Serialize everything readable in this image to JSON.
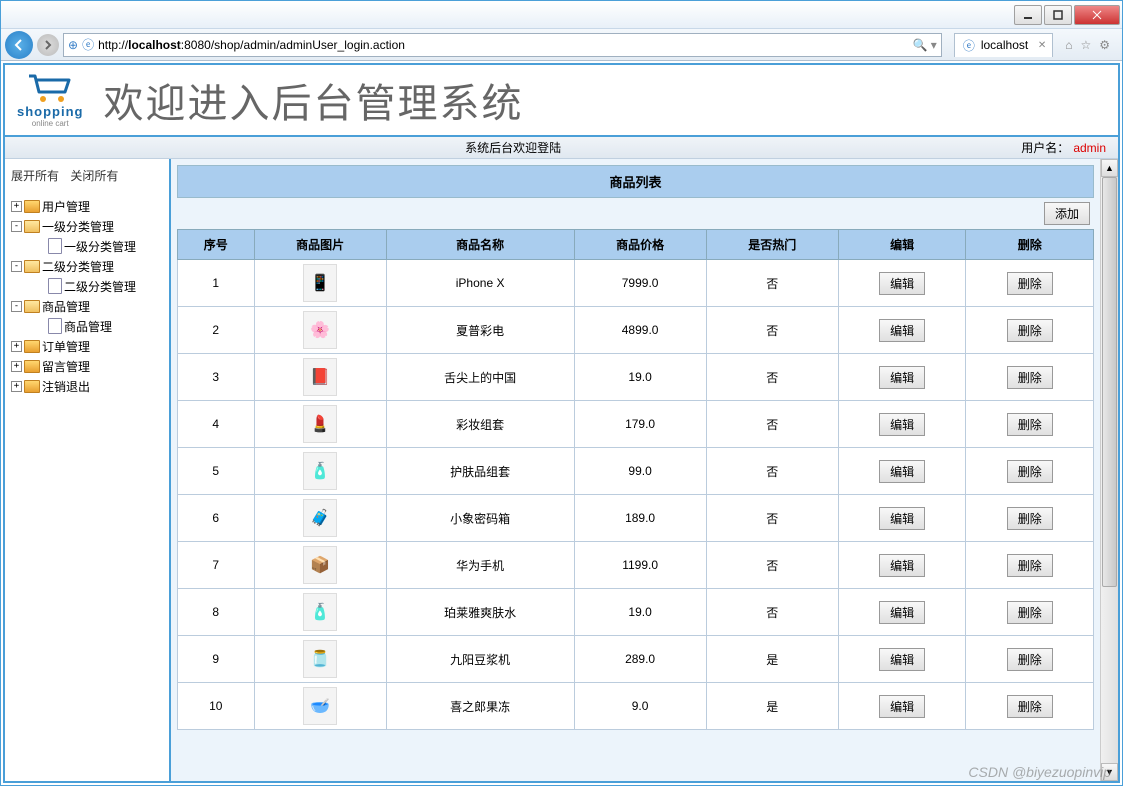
{
  "browser": {
    "url_prefix": "http://",
    "url_host": "localhost",
    "url_port_path": ":8080/shop/admin/adminUser_login.action",
    "tab_title": "localhost",
    "search_hint": ""
  },
  "logo": {
    "line1": "shopping",
    "line2": "online cart"
  },
  "header_title": "欢迎进入后台管理系统",
  "statusbar": {
    "welcome": "系统后台欢迎登陆",
    "user_label": "用户名：",
    "username": "admin"
  },
  "sidebar": {
    "expand_all": "展开所有",
    "collapse_all": "关闭所有",
    "nodes": [
      {
        "label": "用户管理",
        "icon": "folder-closed",
        "toggle": "+",
        "level": 1
      },
      {
        "label": "一级分类管理",
        "icon": "folder-open",
        "toggle": "-",
        "level": 1
      },
      {
        "label": "一级分类管理",
        "icon": "page",
        "toggle": "",
        "level": 2
      },
      {
        "label": "二级分类管理",
        "icon": "folder-open",
        "toggle": "-",
        "level": 1
      },
      {
        "label": "二级分类管理",
        "icon": "page",
        "toggle": "",
        "level": 2
      },
      {
        "label": "商品管理",
        "icon": "folder-open",
        "toggle": "-",
        "level": 1
      },
      {
        "label": "商品管理",
        "icon": "page",
        "toggle": "",
        "level": 2
      },
      {
        "label": "订单管理",
        "icon": "folder-closed",
        "toggle": "+",
        "level": 1
      },
      {
        "label": "留言管理",
        "icon": "folder-closed",
        "toggle": "+",
        "level": 1
      },
      {
        "label": "注销退出",
        "icon": "folder-closed",
        "toggle": "+",
        "level": 1
      }
    ]
  },
  "list": {
    "title": "商品列表",
    "add_btn": "添加",
    "columns": [
      "序号",
      "商品图片",
      "商品名称",
      "商品价格",
      "是否热门",
      "编辑",
      "删除"
    ],
    "edit_btn": "编辑",
    "delete_btn": "删除",
    "rows": [
      {
        "no": "1",
        "thumb": "📱",
        "name": "iPhone X",
        "price": "7999.0",
        "hot": "否"
      },
      {
        "no": "2",
        "thumb": "🌸",
        "name": "夏普彩电",
        "price": "4899.0",
        "hot": "否"
      },
      {
        "no": "3",
        "thumb": "📕",
        "name": "舌尖上的中国",
        "price": "19.0",
        "hot": "否"
      },
      {
        "no": "4",
        "thumb": "💄",
        "name": "彩妆组套",
        "price": "179.0",
        "hot": "否"
      },
      {
        "no": "5",
        "thumb": "🧴",
        "name": "护肤品组套",
        "price": "99.0",
        "hot": "否"
      },
      {
        "no": "6",
        "thumb": "🧳",
        "name": "小象密码箱",
        "price": "189.0",
        "hot": "否"
      },
      {
        "no": "7",
        "thumb": "📦",
        "name": "华为手机",
        "price": "1199.0",
        "hot": "否"
      },
      {
        "no": "8",
        "thumb": "🧴",
        "name": "珀莱雅爽肤水",
        "price": "19.0",
        "hot": "否"
      },
      {
        "no": "9",
        "thumb": "🫙",
        "name": "九阳豆浆机",
        "price": "289.0",
        "hot": "是"
      },
      {
        "no": "10",
        "thumb": "🥣",
        "name": "喜之郎果冻",
        "price": "9.0",
        "hot": "是"
      }
    ]
  },
  "watermark": "CSDN @biyezuopinvip"
}
